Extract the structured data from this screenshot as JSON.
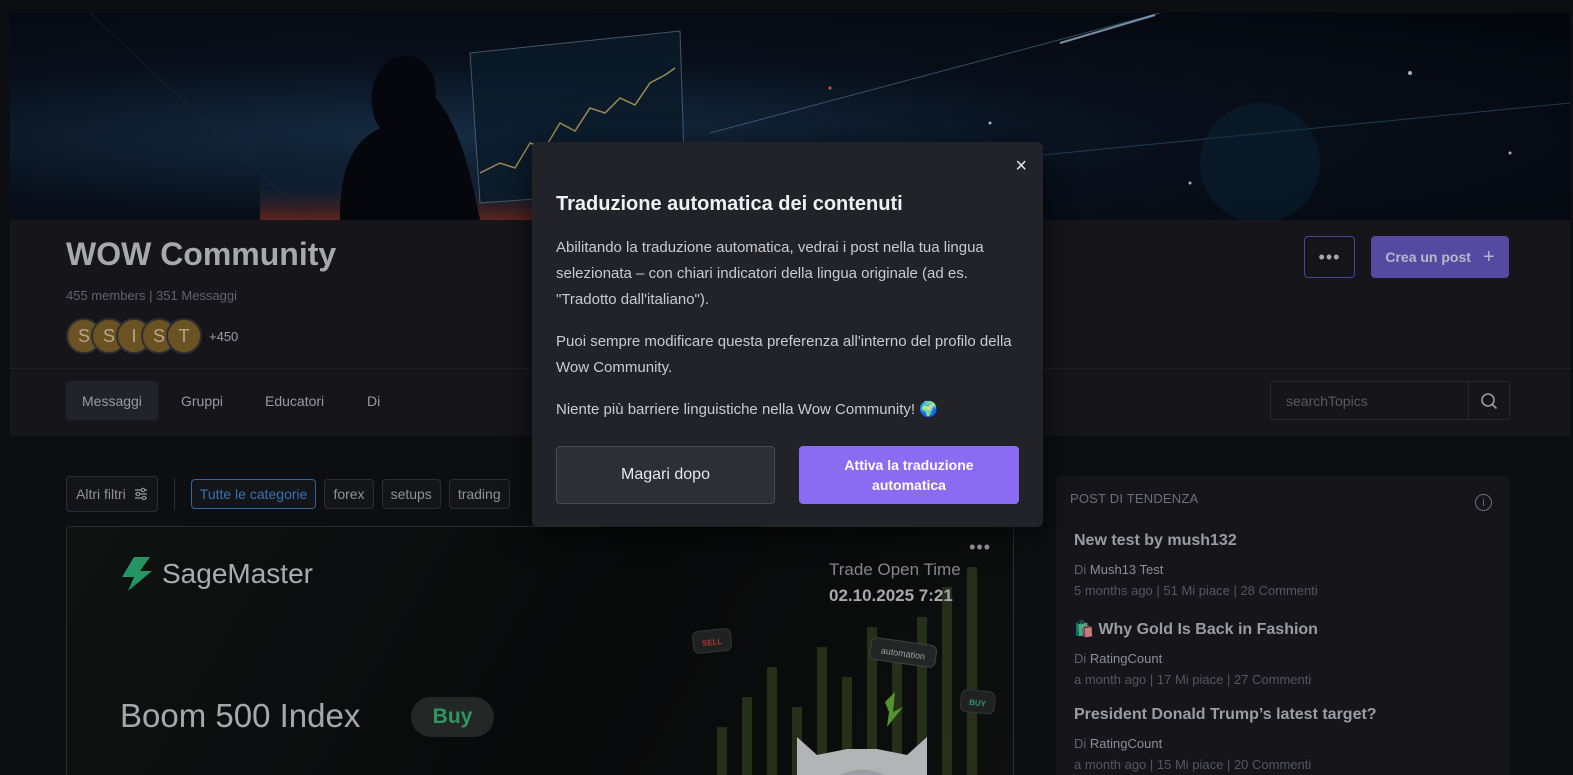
{
  "community": {
    "name": "WOW Community",
    "stats": "455 members | 351 Messaggi",
    "avatars": [
      "S",
      "S",
      "I",
      "S",
      "T"
    ],
    "avatars_more": "+450",
    "more_label": "•••",
    "create_post_label": "Crea un post",
    "create_post_icon": "+"
  },
  "tabs": [
    {
      "label": "Messaggi",
      "active": true
    },
    {
      "label": "Gruppi"
    },
    {
      "label": "Educatori"
    },
    {
      "label": "Di"
    }
  ],
  "search": {
    "placeholder": "searchTopics"
  },
  "filters": {
    "more_filters_label": "Altri filtri",
    "chips": [
      "Tutte le categorie",
      "forex",
      "setups",
      "trading"
    ]
  },
  "post": {
    "menu_label": "•••",
    "brand": "SageMaster",
    "trade_open_label": "Trade Open Time",
    "trade_open_value": "02.10.2025 7:21",
    "instrument": "Boom 500 Index",
    "direction": "Buy",
    "badges": [
      "SELL",
      "automation",
      "BUY"
    ]
  },
  "trending": {
    "title": "POST DI TENDENZA",
    "info_icon": "i",
    "by_label": "Di",
    "items": [
      {
        "title": "New test by mush132",
        "author": "Mush13 Test",
        "meta": "5 months ago | 51 Mi piace | 28 Commenti"
      },
      {
        "title": "🛍️ Why Gold Is Back in Fashion",
        "author": "RatingCount",
        "meta": "a month ago | 17 Mi piace | 27 Commenti"
      },
      {
        "title": "President Donald Trump’s latest target?",
        "author": "RatingCount",
        "meta": "a month ago | 15 Mi piace | 20 Commenti"
      }
    ]
  },
  "modal": {
    "close_label": "×",
    "title": "Traduzione automatica dei contenuti",
    "paragraph1": "Abilitando la traduzione automatica, vedrai i post nella tua lingua selezionata – con chiari indicatori della lingua originale (ad es. \"Tradotto dall'italiano\").",
    "paragraph2": "Puoi sempre modificare questa preferenza all'interno del profilo della Wow Community.",
    "paragraph3": "Niente più barriere linguistiche nella Wow Community! 🌍",
    "later_label": "Magari dopo",
    "enable_label": "Attiva la traduzione automatica"
  },
  "colors": {
    "accent": "#8a6cf2",
    "create_button": "#6e5fd0",
    "active_chip": "#3b82d6",
    "buy_green": "#3fbf7f",
    "background": "#111217"
  }
}
